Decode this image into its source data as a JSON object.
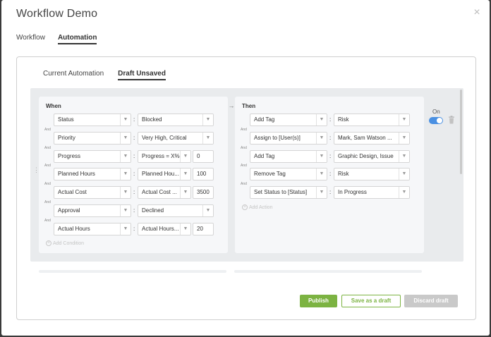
{
  "window": {
    "title": "Workflow Demo",
    "close_glyph": "×"
  },
  "top_tabs": [
    {
      "label": "Workflow"
    },
    {
      "label": "Automation",
      "active": true
    }
  ],
  "sub_tabs": [
    {
      "label": "Current Automation"
    },
    {
      "label": "Draft Unsaved",
      "active": true
    }
  ],
  "when": {
    "title": "When",
    "and_label": "And",
    "add_condition": "Add Condition",
    "conditions": [
      {
        "field": "Status",
        "value": "Blocked"
      },
      {
        "field": "Priority",
        "value": "Very High, Critical"
      },
      {
        "field": "Progress",
        "operator": "Progress = X%",
        "number": "0"
      },
      {
        "field": "Planned Hours",
        "operator": "Planned Hou...",
        "number": "100"
      },
      {
        "field": "Actual Cost",
        "operator": "Actual Cost ...",
        "number": "3500"
      },
      {
        "field": "Approval",
        "value": "Declined"
      },
      {
        "field": "Actual Hours",
        "operator": "Actual Hours...",
        "number": "20"
      }
    ]
  },
  "then": {
    "title": "Then",
    "and_label": "And",
    "add_action": "Add Action",
    "actions": [
      {
        "action": "Add Tag",
        "value": "Risk"
      },
      {
        "action": "Assign to [User(s)]",
        "value": "Mark, Sam Watson ..."
      },
      {
        "action": "Add Tag",
        "value": "Graphic Design, Issue"
      },
      {
        "action": "Remove Tag",
        "value": "Risk"
      },
      {
        "action": "Set Status to [Status]",
        "value": "In Progress"
      }
    ]
  },
  "toggle": {
    "label": "On",
    "enabled": true
  },
  "icons": {
    "caret": "▼",
    "plus": "+",
    "arrow": "→",
    "drag": "⋮",
    "trash": "trash-icon",
    "close": "close-icon"
  },
  "footer": {
    "publish": "Publish",
    "save_draft": "Save as a draft",
    "discard_draft": "Discard draft"
  },
  "colors": {
    "publish_green": "#7cb342",
    "toggle_blue": "#4a90e2",
    "disabled_gray": "#c9c9c9"
  }
}
